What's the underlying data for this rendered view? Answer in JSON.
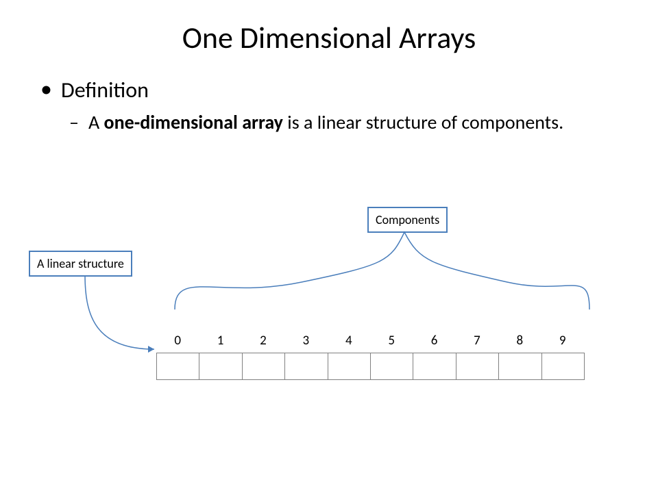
{
  "title": "One Dimensional Arrays",
  "bullet1": "Definition",
  "def_prefix": "A ",
  "def_bold": "one-dimensional array",
  "def_suffix": " is a linear structure of components.",
  "label_components": "Components",
  "label_linear": "A linear structure",
  "indices": [
    "0",
    "1",
    "2",
    "3",
    "4",
    "5",
    "6",
    "7",
    "8",
    "9"
  ]
}
